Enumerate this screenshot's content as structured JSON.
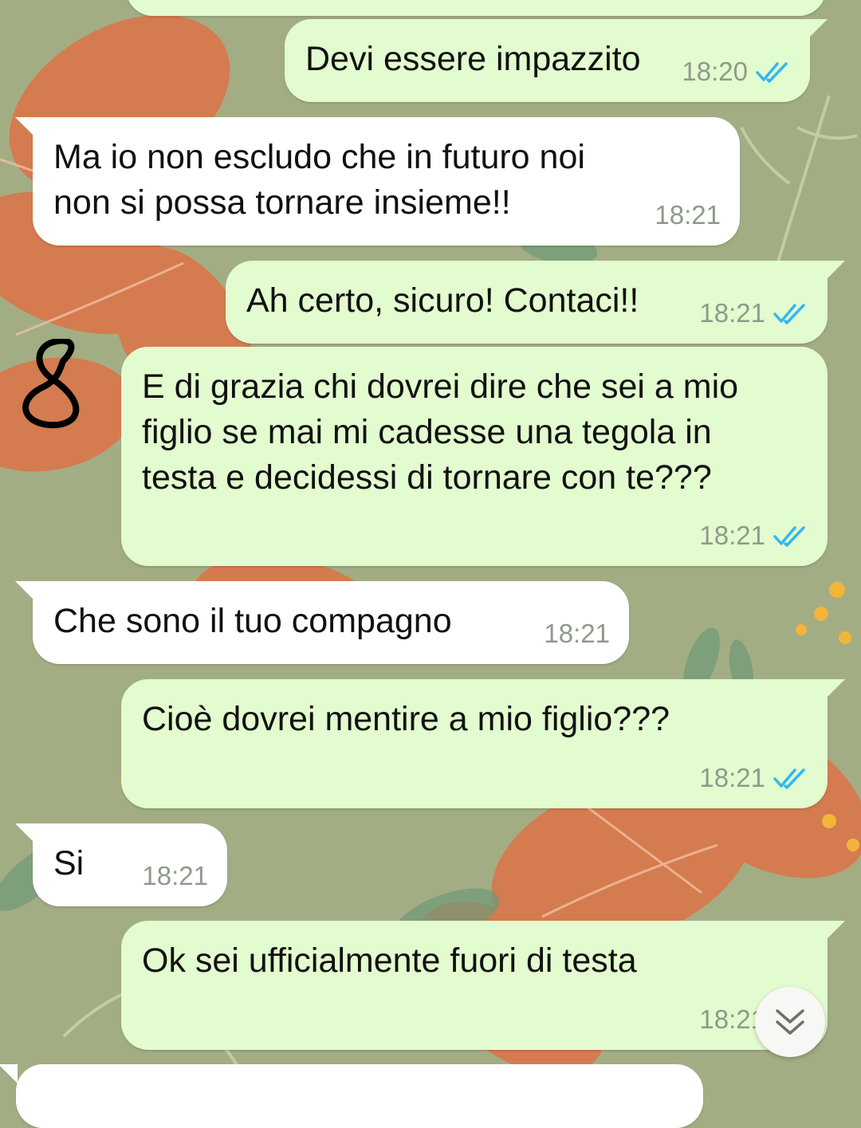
{
  "colors": {
    "wallpaper": "#a3ad84",
    "outgoing_bubble": "#e2fbcf",
    "incoming_bubble": "#ffffff",
    "read_ticks": "#34b7f1",
    "timestamp": "#8e9a8a"
  },
  "messages": [
    {
      "direction": "outgoing",
      "text": "Devi essere impazzito",
      "time": "18:20",
      "status": "read"
    },
    {
      "direction": "incoming",
      "text": "Ma io non escludo che in futuro noi\nnon si possa tornare insieme!!",
      "time": "18:21"
    },
    {
      "direction": "outgoing",
      "text": "Ah certo, sicuro! Contaci!!",
      "time": "18:21",
      "status": "read"
    },
    {
      "direction": "outgoing",
      "text": "E di grazia chi dovrei dire che sei a mio\nfiglio se mai mi cadesse una tegola in\ntesta e decidessi di tornare con te???",
      "time": "18:21",
      "status": "read"
    },
    {
      "direction": "incoming",
      "text": "Che sono il tuo compagno",
      "time": "18:21"
    },
    {
      "direction": "outgoing",
      "text": "Cioè dovrei mentire a mio figlio???",
      "time": "18:21",
      "status": "read"
    },
    {
      "direction": "incoming",
      "text": "Si",
      "time": "18:21"
    },
    {
      "direction": "outgoing",
      "text": "Ok sei ufficialmente fuori di testa",
      "time": "18:21",
      "status": "read"
    }
  ],
  "icons": {
    "read_receipt": "double-check-icon",
    "scroll_down": "chevron-double-down-icon",
    "annotation": "handwritten-doodle"
  }
}
